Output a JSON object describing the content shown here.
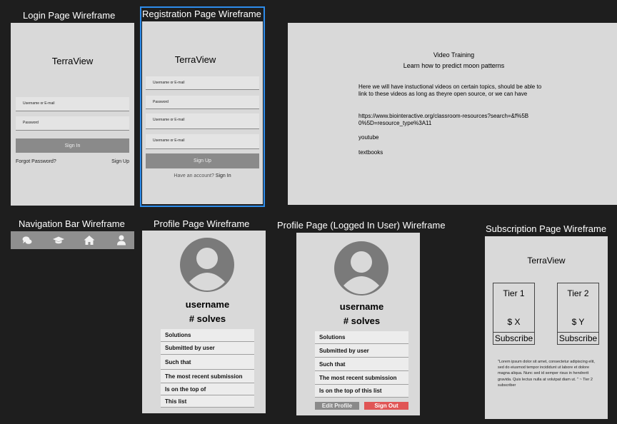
{
  "login": {
    "title": "Login Page Wireframe",
    "brand": "TerraView",
    "username_placeholder": "Username or E-mail",
    "password_placeholder": "Password",
    "signin_label": "Sign In",
    "forgot_label": "Forgot Password?",
    "signup_link": "Sign Up"
  },
  "registration": {
    "title": "Registration Page Wireframe",
    "brand": "TerraView",
    "field1": "Username or E-mail",
    "field2": "Password",
    "field3": "Username or E-mail",
    "field4": "Username or E-mail",
    "signup_label": "Sign Up",
    "have_account": "Have an account?",
    "signin_link": "Sign In",
    "accent": "#2d8ceb"
  },
  "video": {
    "heading": "Video Training",
    "subheading": "Learn how to predict moon patterns",
    "body": "Here we will have instuctional videos on certain topics, should be able to link to these videos as long as theyre open source, or we can have",
    "url": "https://www.biointeractive.org/classroom-resources?search=&f%5B0%5D=resource_type%3A11",
    "item1": "youtube",
    "item2": "textbooks"
  },
  "navbar": {
    "title": "Navigation Bar Wireframe",
    "icons": [
      "chat-icon",
      "graduation-cap-icon",
      "home-icon",
      "user-icon"
    ]
  },
  "profile": {
    "title": "Profile Page Wireframe",
    "username": "username",
    "solves": "# solves",
    "rows": [
      "Solutions",
      "Submitted by user",
      "Such that",
      "The most recent submission",
      "Is on the top of",
      "This list"
    ]
  },
  "profile_logged": {
    "title": "Profile Page (Logged In User) Wireframe",
    "username": "username",
    "solves": "# solves",
    "rows": [
      "Solutions",
      "Submitted by user",
      "Such that",
      "The most recent submission",
      "Is on the top of this list"
    ],
    "edit_label": "Edit Profile",
    "signout_label": "Sign Out",
    "signout_color": "#e05555"
  },
  "subscription": {
    "title": "Subscription Page Wireframe",
    "brand": "TerraView",
    "tier1_name": "Tier 1",
    "tier1_price": "$ X",
    "tier2_name": "Tier 2",
    "tier2_price": "$ Y",
    "subscribe_label": "Subscribe",
    "quote": "\"Lorem ipsum dolor sit amet, consectetur adipiscing elit, sed do eiusmod tempor incididunt ut labore et dolore magna aliqua. Nunc sed id semper risus in hendrerit gravida. Quis lectus nulla at volutpat diam ut. \"  ~ Tier 2 subscriber"
  }
}
